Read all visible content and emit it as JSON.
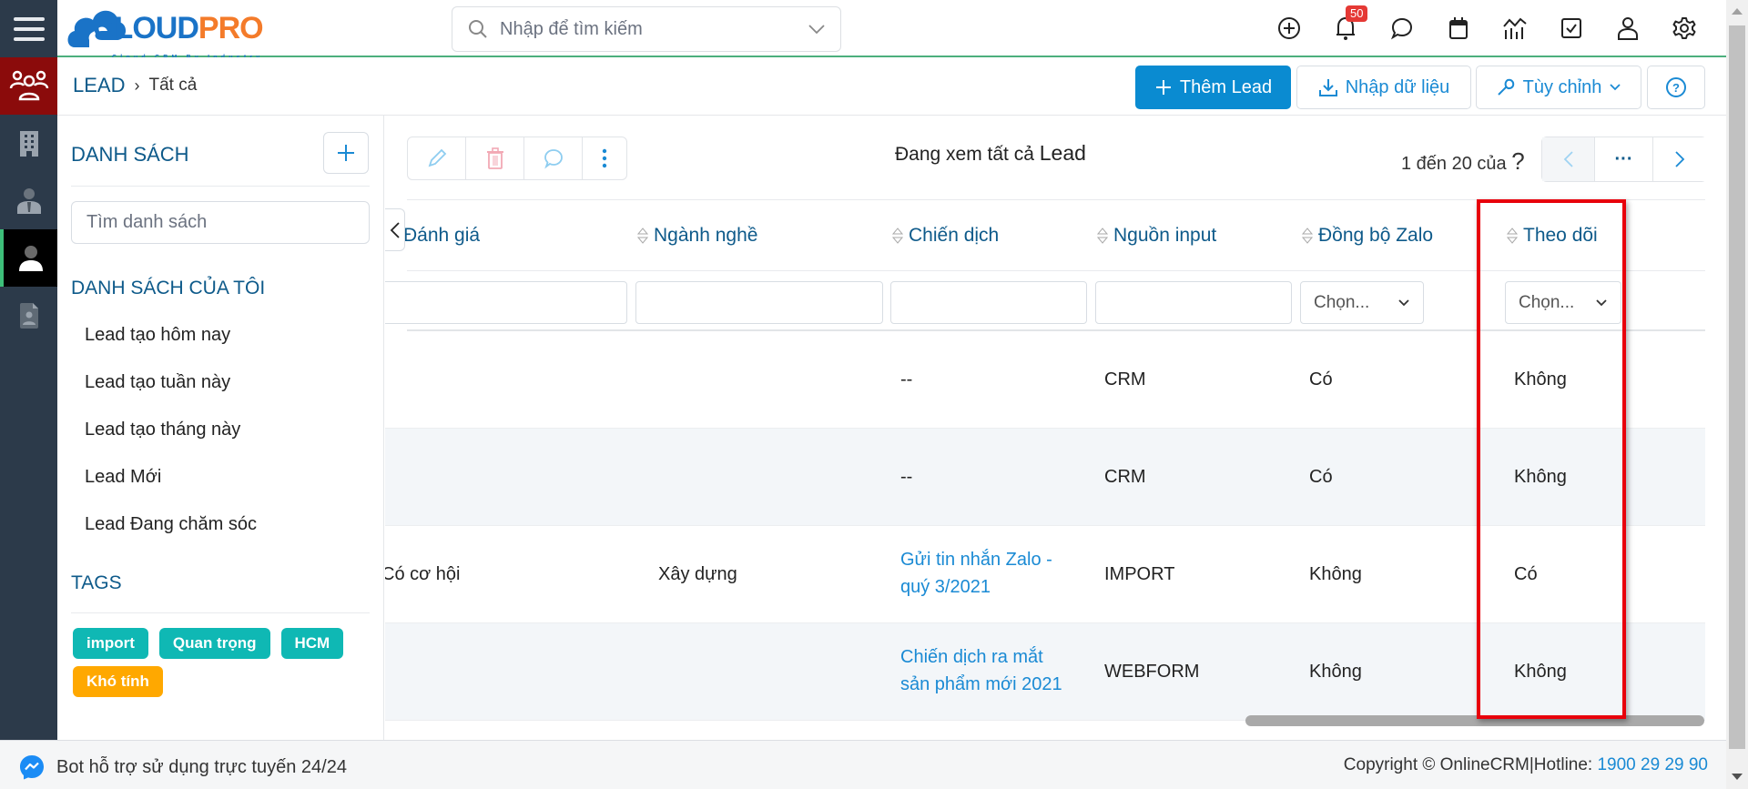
{
  "app": {
    "logo_text_a": "CLOUD",
    "logo_text_b": "PRO",
    "logo_tagline": "Cloud CRM By Industry",
    "search_placeholder": "Nhập để tìm kiếm",
    "notification_count": "50",
    "top_icons": [
      "plus-circle-icon",
      "bell-icon",
      "chat-icon",
      "calendar-icon",
      "report-chart-icon",
      "task-check-icon",
      "user-icon",
      "gear-icon"
    ]
  },
  "sidebar": {
    "items": [
      {
        "name": "leads",
        "icon": "users-group-icon",
        "active": true
      },
      {
        "name": "organizations",
        "icon": "building-icon"
      },
      {
        "name": "contacts",
        "icon": "person-tie-icon"
      },
      {
        "name": "lead",
        "icon": "person-icon",
        "selected": true
      },
      {
        "name": "documents",
        "icon": "contact-file-icon"
      }
    ]
  },
  "breadcrumb": {
    "root": "LEAD",
    "separator": "›",
    "current": "Tất cả"
  },
  "actions": {
    "add_lead": "Thêm Lead",
    "import": "Nhập dữ liệu",
    "customize": "Tùy chỉnh"
  },
  "left_panel": {
    "list_title": "DANH SÁCH",
    "search_placeholder": "Tìm danh sách",
    "my_lists_title": "DANH SÁCH CỦA TÔI",
    "my_lists": [
      "Lead tạo hôm nay",
      "Lead tạo tuần này",
      "Lead tạo tháng này",
      "Lead Mới",
      "Lead Đang chăm sóc"
    ],
    "tags_title": "TAGS",
    "tags": [
      {
        "label": "import",
        "color": "#0fb8b4"
      },
      {
        "label": "Quan trọng",
        "color": "#0fb8b4"
      },
      {
        "label": "HCM",
        "color": "#0fb8b4"
      },
      {
        "label": "Khó tính",
        "color": "#ffa800"
      }
    ]
  },
  "content": {
    "viewing_prefix": "Đang xem tất cả",
    "viewing_module": "Lead",
    "page_info": "1 đến 20 của",
    "page_unknown": "?",
    "pager_more": "···",
    "columns": [
      "Đánh giá",
      "Ngành nghề",
      "Chiến dịch",
      "Nguồn input",
      "Đồng bộ Zalo",
      "Theo dõi"
    ],
    "filter_select_placeholder": "Chọn...",
    "rows": [
      {
        "danh_gia": "",
        "nganh_nghe": "",
        "chien_dich": "--",
        "nguon": "CRM",
        "zalo": "Có",
        "theo_doi": "Không"
      },
      {
        "danh_gia": "",
        "nganh_nghe": "",
        "chien_dich": "--",
        "nguon": "CRM",
        "zalo": "Có",
        "theo_doi": "Không"
      },
      {
        "danh_gia": "Có cơ hội",
        "nganh_nghe": "Xây dựng",
        "chien_dich_l1": "Gửi tin nhắn Zalo -",
        "chien_dich_l2": "quý 3/2021",
        "nguon": "IMPORT",
        "zalo": "Không",
        "theo_doi": "Có"
      },
      {
        "danh_gia": "",
        "nganh_nghe": "",
        "chien_dich_l1": "Chiến dịch ra mắt",
        "chien_dich_l2": "sản phẩm mới 2021",
        "nguon": "WEBFORM",
        "zalo": "Không",
        "theo_doi": "Không"
      }
    ],
    "highlighted_column": "Theo dõi"
  },
  "footer": {
    "bot_text": "Bot hỗ trợ sử dụng trực tuyến 24/24",
    "copyright": "Copyright © OnlineCRM|Hotline:",
    "hotline": "1900 29 29 90"
  },
  "colors": {
    "brand_blue": "#0a8bd1",
    "header_text": "#0e5a8a",
    "sidebar_bg": "#2c3a4a",
    "active_module": "#8b0b0b",
    "highlight": "#e8000b"
  }
}
